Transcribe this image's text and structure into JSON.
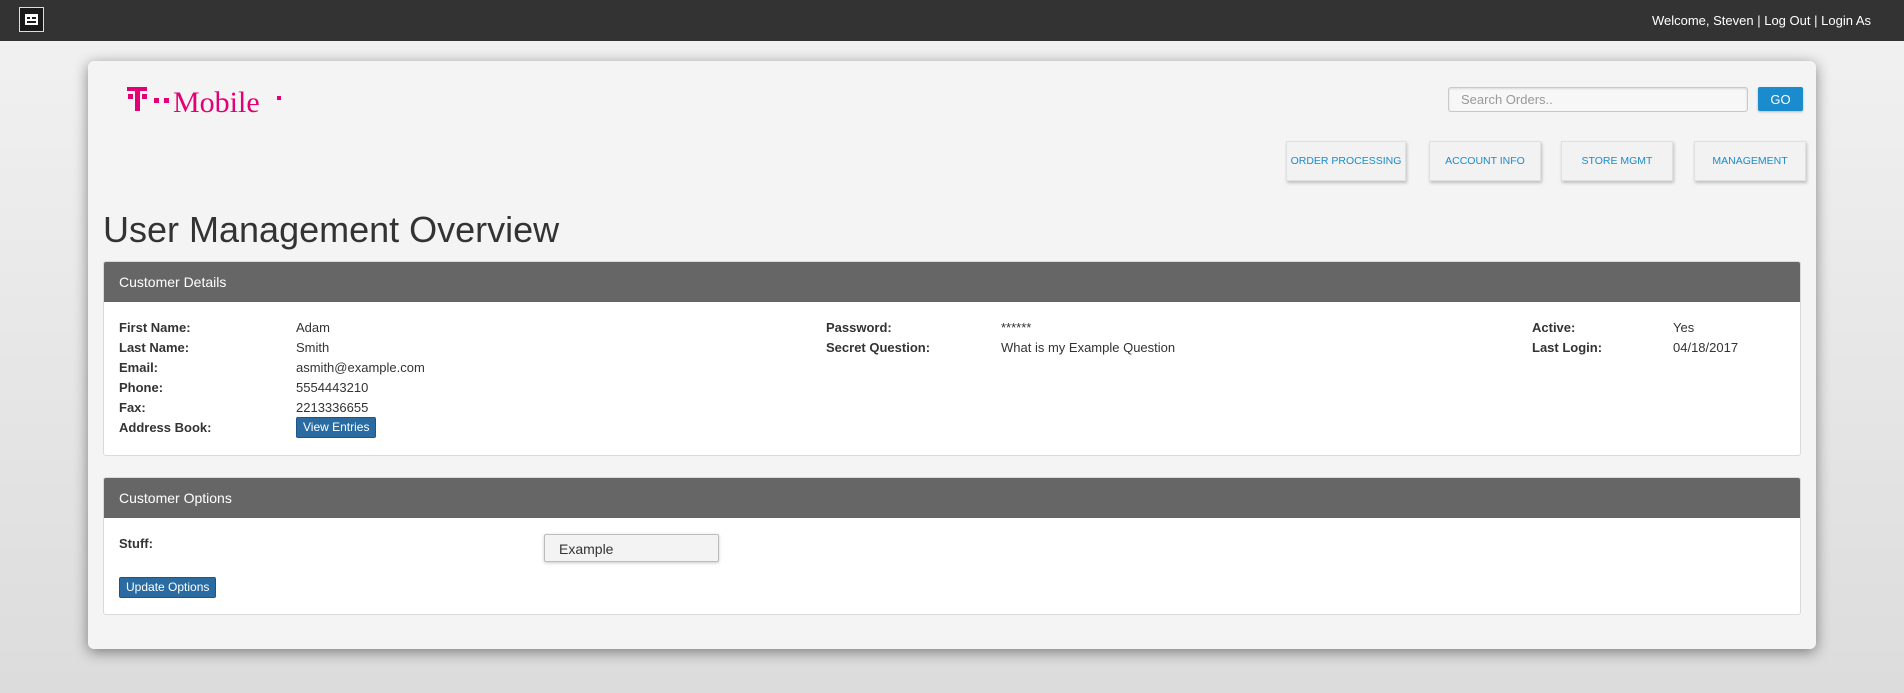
{
  "topbar": {
    "welcome": "Welcome, Steven",
    "separator": "|",
    "logout": "Log Out",
    "login_as": "Login As"
  },
  "brand": {
    "name": "T · · Mobile ·",
    "color": "#e20074"
  },
  "search": {
    "placeholder": "Search Orders..",
    "go_label": "GO"
  },
  "nav": [
    {
      "label": "ORDER PROCESSING"
    },
    {
      "label": "ACCOUNT INFO"
    },
    {
      "label": "STORE MGMT"
    },
    {
      "label": "MANAGEMENT"
    }
  ],
  "page_title": "User Management Overview",
  "customer_details": {
    "heading": "Customer Details",
    "first_name_label": "First Name:",
    "first_name": "Adam",
    "last_name_label": "Last Name:",
    "last_name": "Smith",
    "email_label": "Email:",
    "email": "asmith@example.com",
    "phone_label": "Phone:",
    "phone": "5554443210",
    "fax_label": "Fax:",
    "fax": "2213336655",
    "address_book_label": "Address Book:",
    "view_entries": "View Entries",
    "password_label": "Password:",
    "password": "******",
    "secret_question_label": "Secret Question:",
    "secret_question": "What is my Example Question",
    "active_label": "Active:",
    "active": "Yes",
    "last_login_label": "Last Login:",
    "last_login": "04/18/2017"
  },
  "customer_options": {
    "heading": "Customer Options",
    "stuff_label": "Stuff:",
    "stuff_value": "Example",
    "update_button": "Update Options"
  },
  "colors": {
    "accent": "#1a8bcd",
    "panel_header": "#666666",
    "topbar": "#333333",
    "button": "#2a6ba2"
  }
}
